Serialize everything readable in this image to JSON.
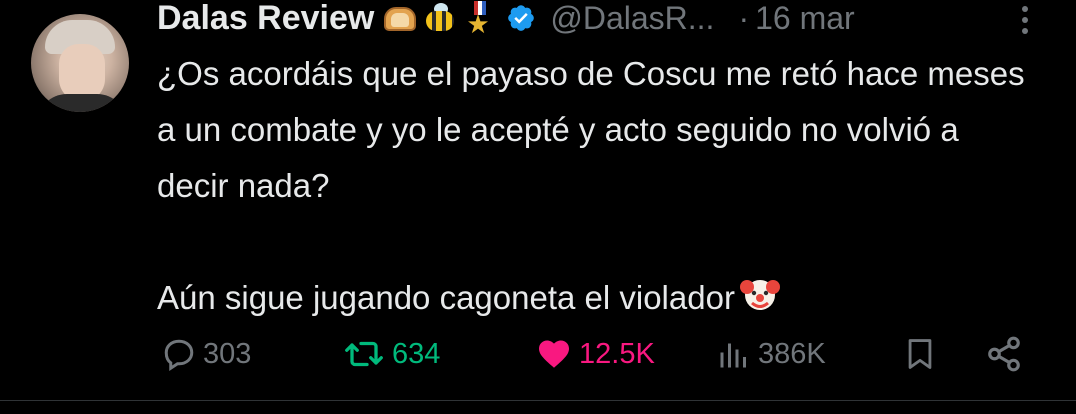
{
  "tweet": {
    "author_name": "Dalas Review",
    "handle": "@DalasR...",
    "separator": "·",
    "date": "16 mar",
    "badges": [
      "bread-icon",
      "bee-icon",
      "medal-icon",
      "verified-icon"
    ],
    "text_paragraph_1": "¿Os acordáis que el payaso de Coscu me retó hace meses a un combate y yo le acepté y acto seguido no volvió a decir nada?",
    "text_paragraph_2": "Aún sigue jugando cagoneta el violador",
    "text_emoji": "clown-face-icon"
  },
  "actions": {
    "reply_count": "303",
    "retweet_count": "634",
    "like_count": "12.5K",
    "views_count": "386K"
  },
  "colors": {
    "background": "#000000",
    "text_primary": "#e7e9ea",
    "text_secondary": "#71767b",
    "retweet_active": "#00ba7c",
    "like_active": "#f91880",
    "verified": "#1d9bf0"
  }
}
